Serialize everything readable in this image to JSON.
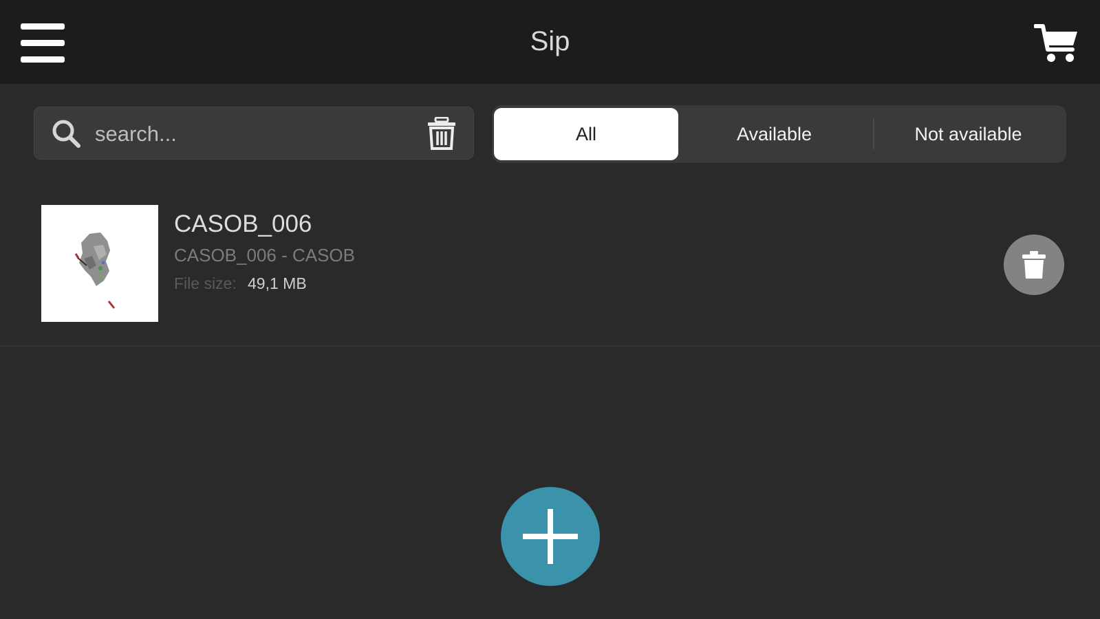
{
  "header": {
    "title": "Sip",
    "menu_icon": "hamburger-menu-icon",
    "cart_icon": "shopping-cart-icon"
  },
  "search": {
    "placeholder": "search...",
    "value": "",
    "search_icon": "search-icon",
    "clear_icon": "trash-icon"
  },
  "filter": {
    "options": [
      "All",
      "Available",
      "Not available"
    ],
    "selected": "All"
  },
  "items": [
    {
      "title": "CASOB_006",
      "subtitle": "CASOB_006 - CASOB",
      "size_label": "File size:",
      "size_value": "49,1 MB",
      "delete_icon": "trash-icon"
    }
  ],
  "fab": {
    "icon": "plus-icon",
    "color": "#3a93ab"
  },
  "colors": {
    "topbar": "#1c1c1c",
    "background": "#2a2a2a",
    "accent": "#3a93ab"
  }
}
